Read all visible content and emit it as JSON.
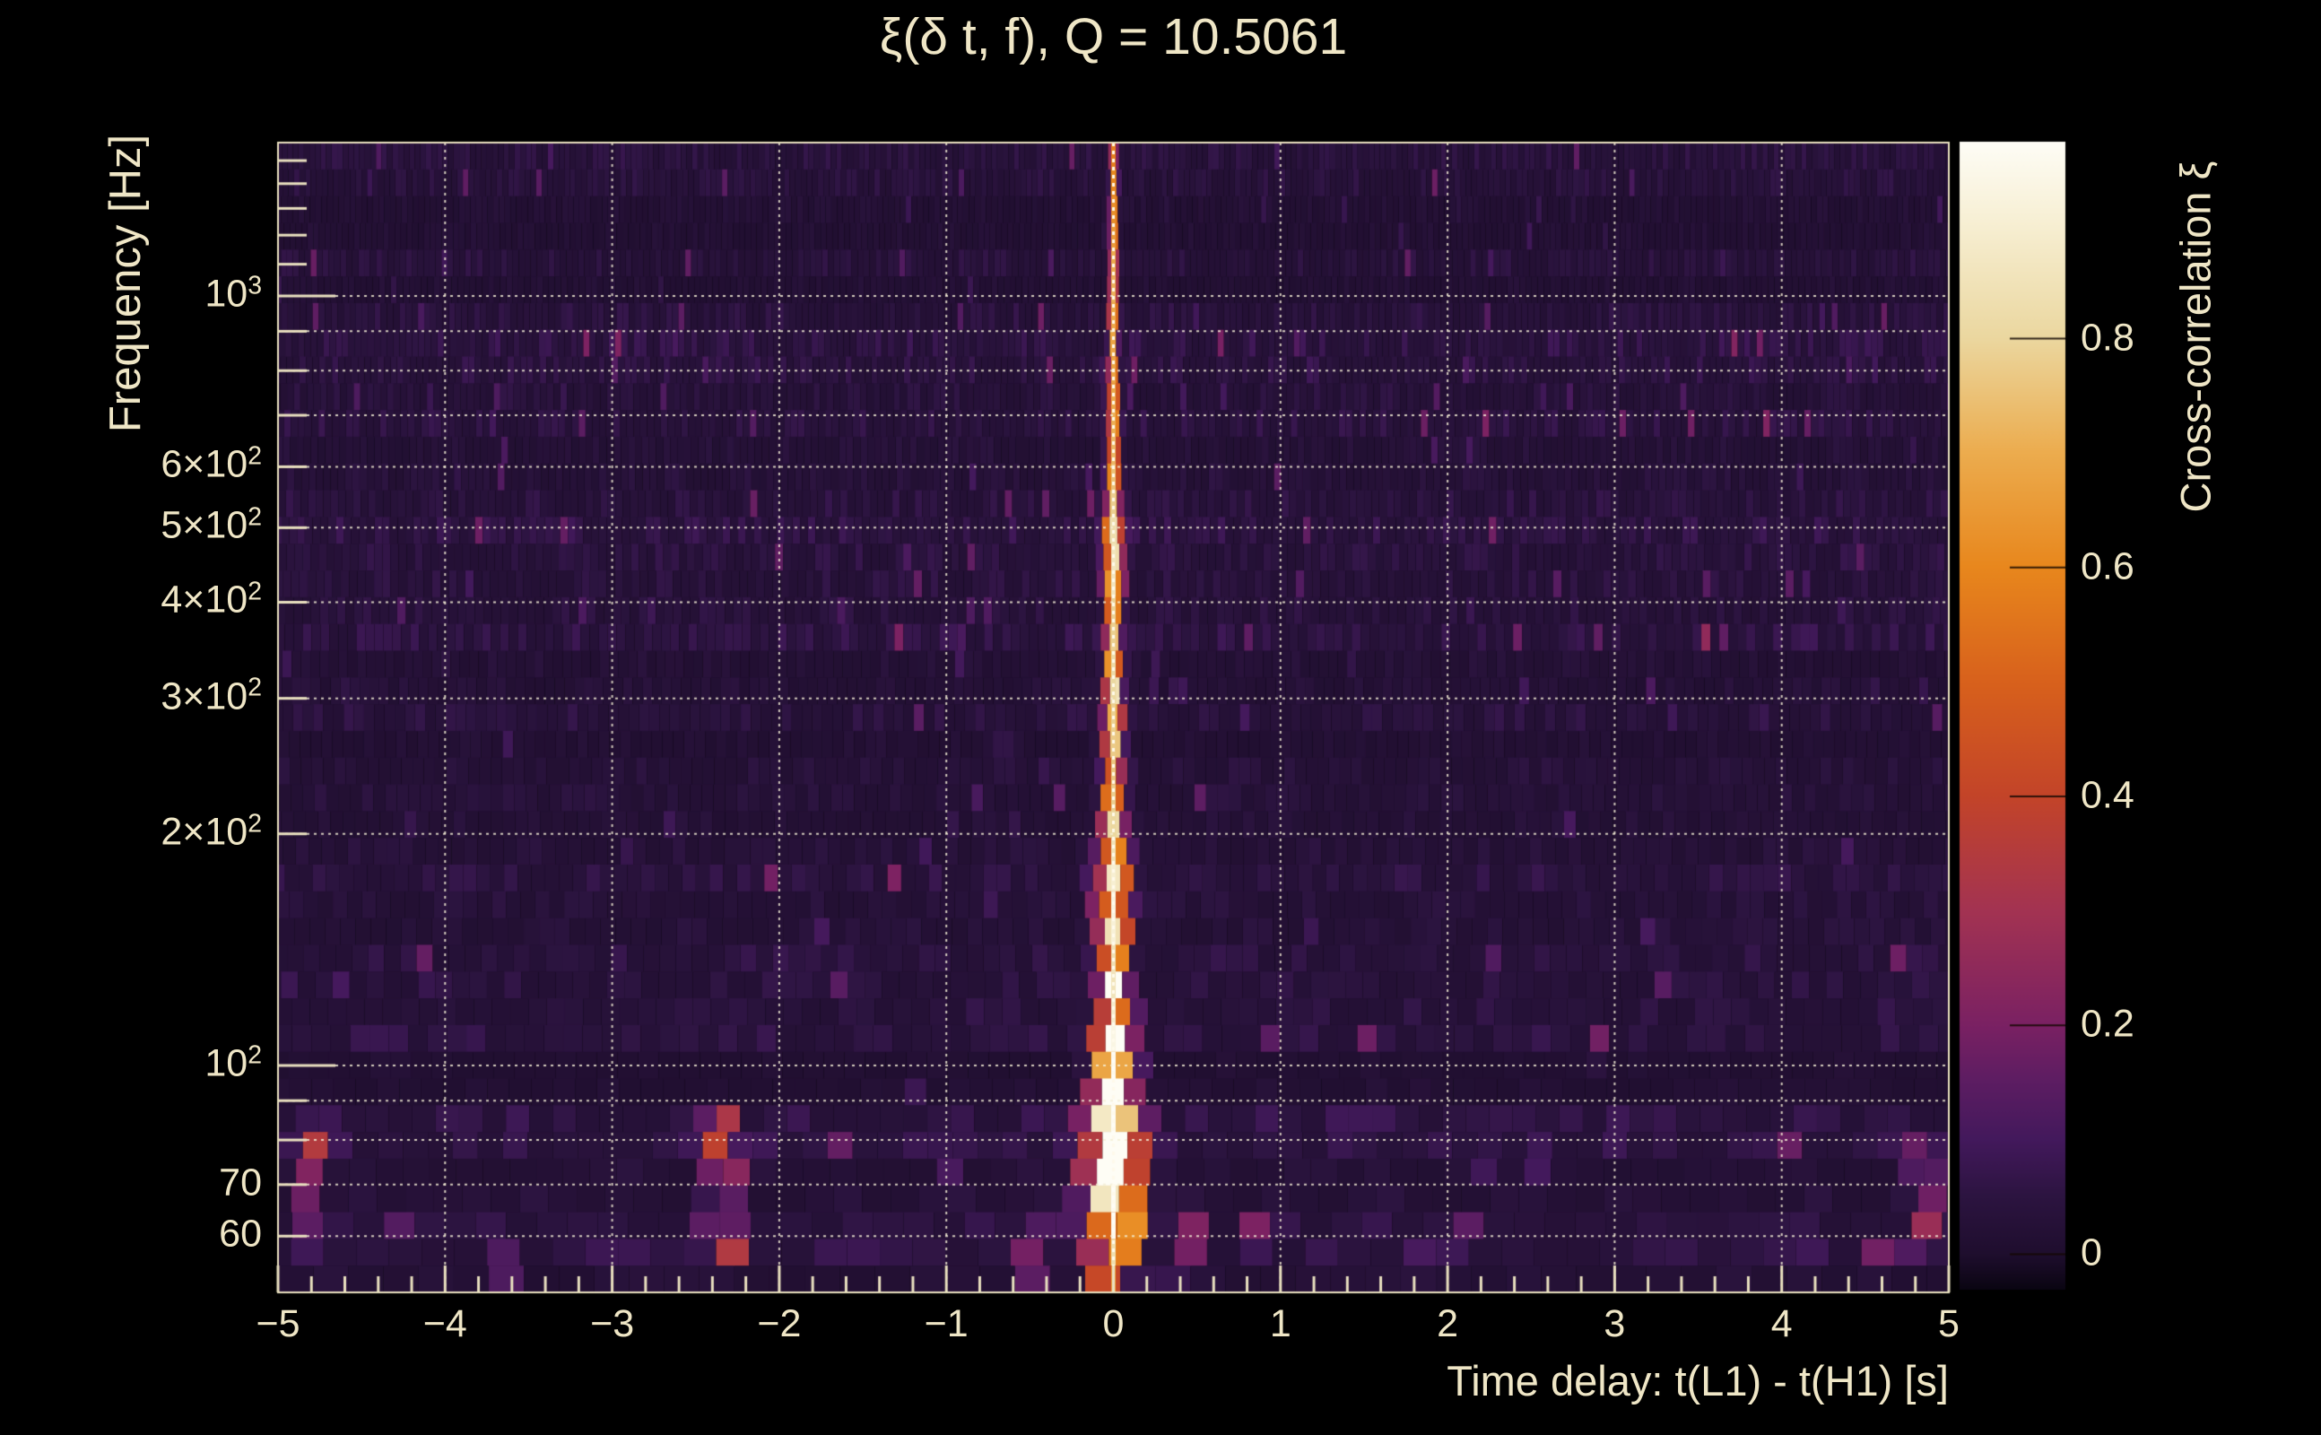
{
  "chart_data": {
    "type": "heatmap",
    "title": "ξ(δ t, f), Q = 10.5061",
    "q_value": 10.5061,
    "xlabel": "Time delay: t(L1) - t(H1) [s]",
    "ylabel": "Frequency [Hz]",
    "zlabel": "Cross-correlation ξ",
    "x_range_s": [
      -5,
      5
    ],
    "y_range_hz": [
      50.7,
      1583
    ],
    "y_scale": "log",
    "z_range": [
      -0.031,
      0.972
    ],
    "grid": {
      "style": "dotted",
      "x_major_step": 1
    },
    "x_ticks": [
      {
        "v": -5,
        "label": "−5"
      },
      {
        "v": -4,
        "label": "−4"
      },
      {
        "v": -3,
        "label": "−3"
      },
      {
        "v": -2,
        "label": "−2"
      },
      {
        "v": -1,
        "label": "−1"
      },
      {
        "v": 0,
        "label": "0"
      },
      {
        "v": 1,
        "label": "1"
      },
      {
        "v": 2,
        "label": "2"
      },
      {
        "v": 3,
        "label": "3"
      },
      {
        "v": 4,
        "label": "4"
      },
      {
        "v": 5,
        "label": "5"
      }
    ],
    "x_minor_step": 0.2,
    "y_ticks": [
      {
        "v": 1000,
        "base": "10",
        "sup": "3"
      },
      {
        "v": 600,
        "base": "6×10",
        "sup": "2"
      },
      {
        "v": 500,
        "base": "5×10",
        "sup": "2"
      },
      {
        "v": 400,
        "base": "4×10",
        "sup": "2"
      },
      {
        "v": 300,
        "base": "3×10",
        "sup": "2"
      },
      {
        "v": 200,
        "base": "2×10",
        "sup": "2"
      },
      {
        "v": 100,
        "base": "10",
        "sup": "2"
      },
      {
        "v": 70,
        "base": "70",
        "sup": ""
      },
      {
        "v": 60,
        "base": "60",
        "sup": ""
      }
    ],
    "y_gridlines_hz": [
      60,
      70,
      80,
      90,
      100,
      200,
      300,
      400,
      500,
      600,
      700,
      800,
      900,
      1000
    ],
    "y_minor_ticks_hz": [
      60,
      70,
      80,
      90,
      200,
      300,
      400,
      500,
      600,
      700,
      800,
      900,
      1100,
      1200,
      1300,
      1400,
      1500
    ],
    "colorbar": {
      "ticks": [
        {
          "v": 0.8,
          "label": "0.8"
        },
        {
          "v": 0.6,
          "label": "0.6"
        },
        {
          "v": 0.4,
          "label": "0.4"
        },
        {
          "v": 0.2,
          "label": "0.2"
        },
        {
          "v": 0.0,
          "label": "0"
        }
      ],
      "colormap_stops": [
        [
          -0.031,
          "#0a0512"
        ],
        [
          0.0,
          "#1f0e2e"
        ],
        [
          0.05,
          "#2c1440"
        ],
        [
          0.1,
          "#43195c"
        ],
        [
          0.15,
          "#5c1d62"
        ],
        [
          0.2,
          "#7a2163"
        ],
        [
          0.3,
          "#a33352"
        ],
        [
          0.4,
          "#c34429"
        ],
        [
          0.5,
          "#d8611c"
        ],
        [
          0.6,
          "#e8871d"
        ],
        [
          0.7,
          "#ecac4e"
        ],
        [
          0.8,
          "#ebd79f"
        ],
        [
          0.9,
          "#f7efd3"
        ],
        [
          0.972,
          "#fefdf6"
        ]
      ]
    },
    "signal_ridge": {
      "t0_s": 0,
      "core_halfwidth_s": 0.012,
      "profile": [
        {
          "f": 1500,
          "xi": 0.4,
          "sigma_s": 0.015
        },
        {
          "f": 1250,
          "xi": 0.46,
          "sigma_s": 0.016
        },
        {
          "f": 1050,
          "xi": 0.54,
          "sigma_s": 0.018
        },
        {
          "f": 900,
          "xi": 0.5,
          "sigma_s": 0.02
        },
        {
          "f": 780,
          "xi": 0.5,
          "sigma_s": 0.022
        },
        {
          "f": 650,
          "xi": 0.54,
          "sigma_s": 0.025
        },
        {
          "f": 560,
          "xi": 0.58,
          "sigma_s": 0.028
        },
        {
          "f": 480,
          "xi": 0.66,
          "sigma_s": 0.045
        },
        {
          "f": 430,
          "xi": 0.7,
          "sigma_s": 0.042
        },
        {
          "f": 380,
          "xi": 0.58,
          "sigma_s": 0.03
        },
        {
          "f": 330,
          "xi": 0.64,
          "sigma_s": 0.035
        },
        {
          "f": 280,
          "xi": 0.6,
          "sigma_s": 0.04
        },
        {
          "f": 240,
          "xi": 0.58,
          "sigma_s": 0.045
        },
        {
          "f": 205,
          "xi": 0.62,
          "sigma_s": 0.05
        },
        {
          "f": 175,
          "xi": 0.72,
          "sigma_s": 0.065
        },
        {
          "f": 155,
          "xi": 0.76,
          "sigma_s": 0.07
        },
        {
          "f": 135,
          "xi": 0.64,
          "sigma_s": 0.055
        },
        {
          "f": 115,
          "xi": 0.72,
          "sigma_s": 0.07
        },
        {
          "f": 100,
          "xi": 0.8,
          "sigma_s": 0.08
        },
        {
          "f": 88,
          "xi": 0.88,
          "sigma_s": 0.09
        },
        {
          "f": 78,
          "xi": 0.95,
          "sigma_s": 0.11
        },
        {
          "f": 68,
          "xi": 0.9,
          "sigma_s": 0.12
        },
        {
          "f": 60,
          "xi": 0.78,
          "sigma_s": 0.1
        },
        {
          "f": 54,
          "xi": 0.5,
          "sigma_s": 0.07
        }
      ]
    },
    "anomalies": [
      {
        "t_s": -2.35,
        "f_hz": [
          53,
          86
        ],
        "xi": 0.3,
        "w_s": 0.06
      },
      {
        "t_s": -4.78,
        "f_hz": [
          60,
          80
        ],
        "xi": 0.26,
        "w_s": 0.05
      },
      {
        "t_s": -0.52,
        "f_hz": [
          52,
          64
        ],
        "xi": 0.2,
        "w_s": 0.05
      },
      {
        "t_s": 0.45,
        "f_hz": [
          52,
          63
        ],
        "xi": 0.22,
        "w_s": 0.05
      },
      {
        "t_s": 1.9,
        "f_hz": [
          52,
          60
        ],
        "xi": 0.15,
        "w_s": 0.05
      },
      {
        "t_s": 4.85,
        "f_hz": [
          55,
          78
        ],
        "xi": 0.17,
        "w_s": 0.06
      },
      {
        "t_s": -3.6,
        "f_hz": [
          52,
          60
        ],
        "xi": 0.13,
        "w_s": 0.04
      }
    ],
    "noise_texture": {
      "seed": 7,
      "n_freq_rows": 43,
      "base_xi": 0.03,
      "bands": [
        {
          "f_hz": [
            88,
            103
          ],
          "gain": 0.35
        },
        {
          "f_hz": [
            50,
            56
          ],
          "gain": 0.5
        },
        {
          "f_hz": [
            220,
            265
          ],
          "gain": 0.6
        },
        {
          "f_hz": [
            150,
            190
          ],
          "gain": 1.2
        },
        {
          "f_hz": [
            900,
            1600
          ],
          "gain": 0.8
        }
      ]
    },
    "colors": {
      "background": "#000000",
      "text": "#efe6c6",
      "frame": "#e9e0bf",
      "gridline": "#f5eed6",
      "zero_line": "#fffaeb"
    }
  }
}
